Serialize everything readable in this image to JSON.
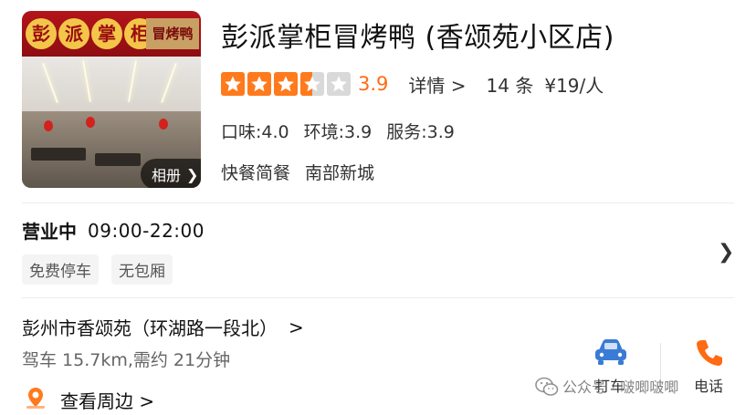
{
  "store": {
    "name": "彭派掌柜冒烤鸭 (香颂苑小区店)",
    "photo": {
      "sign_glyphs": [
        "彭",
        "派",
        "掌",
        "柜"
      ],
      "sign_right": "冒烤鸭",
      "album_label": "相册",
      "album_icon": "chevron-right-icon"
    },
    "rating": {
      "stars": 3.5,
      "max_stars": 5,
      "score": "3.9",
      "detail_label": "详情 >",
      "review_count": "14 条",
      "price_per_person": "¥19/人",
      "star_color": "#ff7a1c",
      "score_color": "#ff6a14"
    },
    "sub_scores": [
      "口味:4.0",
      "环境:3.9",
      "服务:3.9"
    ],
    "tags": [
      "快餐简餐",
      "南部新城"
    ]
  },
  "hours": {
    "status": "营业中",
    "time": "09:00-22:00",
    "facilities": [
      "免费停车",
      "无包厢"
    ],
    "chevron_icon": "chevron-right-icon"
  },
  "address": {
    "text": "彭州市香颂苑（环湖路一段北）",
    "chevron": ">",
    "drive_info": "驾车 15.7km,需约 21分钟",
    "nearby_label": "查看周边 >",
    "nearby_icon": "location-pin-icon"
  },
  "actions": {
    "taxi_label": "打车",
    "taxi_icon": "car-icon",
    "taxi_color": "#3a7bd5",
    "phone_label": "电话",
    "phone_icon": "phone-icon",
    "phone_color": "#ff6a14"
  },
  "watermark": {
    "text": "公众号 · 啵唧啵唧",
    "icon": "wechat-icon"
  }
}
